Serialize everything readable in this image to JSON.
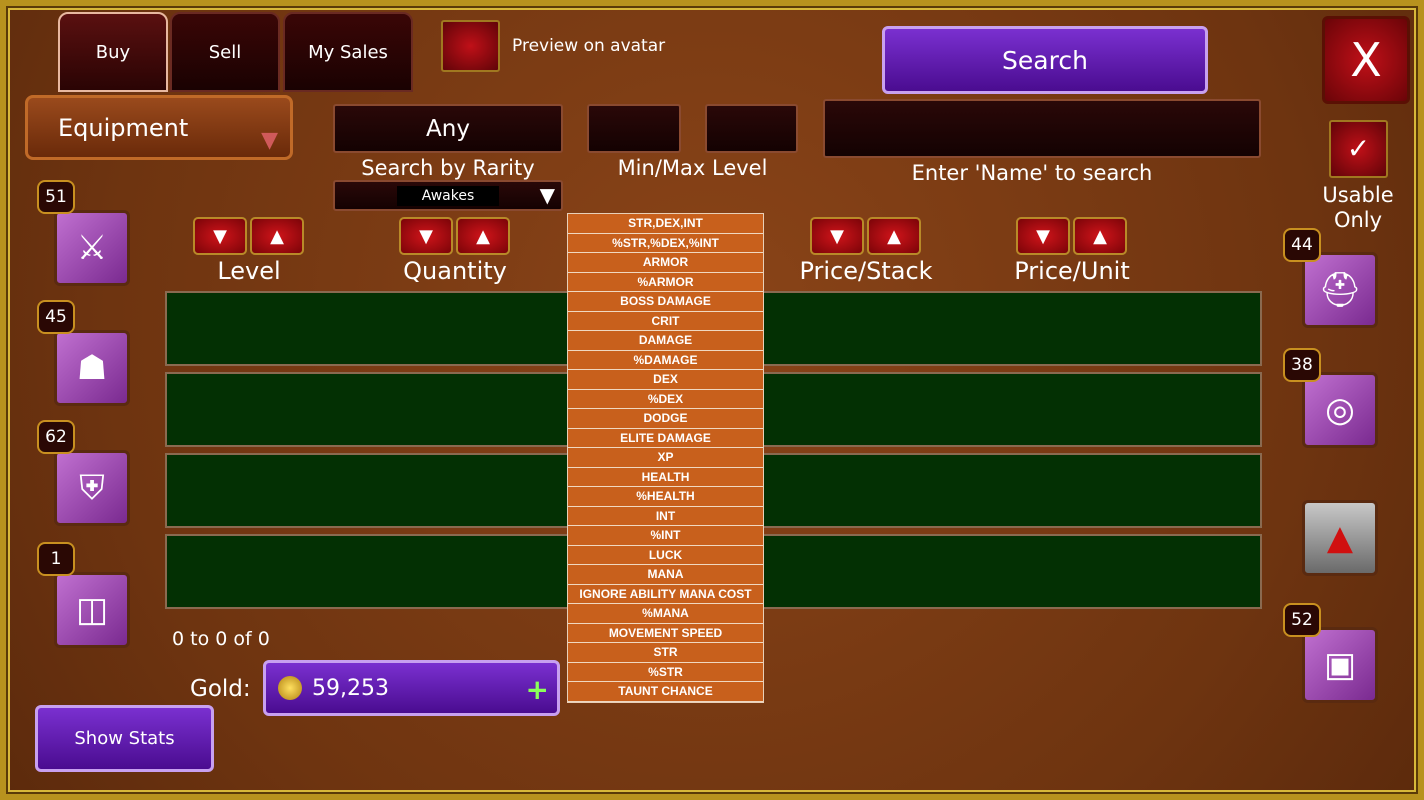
{
  "tabs": [
    {
      "label": "Buy",
      "active": true
    },
    {
      "label": "Sell"
    },
    {
      "label": "My Sales"
    }
  ],
  "preview_label": "Preview on avatar",
  "search_button": "Search",
  "close_label": "X",
  "category": "Equipment",
  "rarity": {
    "value": "Any",
    "label": "Search by Rarity"
  },
  "level_label": "Min/Max Level",
  "name_label": "Enter 'Name' to search",
  "stat_filter": "Awakes",
  "usable_only": {
    "label": "Usable Only",
    "checked": true
  },
  "sort_columns": [
    "Level",
    "Quantity",
    "Price/Stack",
    "Price/Unit"
  ],
  "stat_options": [
    "STR,DEX,INT",
    "%STR,%DEX,%INT",
    "ARMOR",
    "%ARMOR",
    "BOSS DAMAGE",
    "CRIT",
    "DAMAGE",
    "%DAMAGE",
    "DEX",
    "%DEX",
    "DODGE",
    "ELITE DAMAGE",
    "XP",
    "HEALTH",
    "%HEALTH",
    "INT",
    "%INT",
    "LUCK",
    "MANA",
    "IGNORE ABILITY MANA COST",
    "%MANA",
    "MOVEMENT SPEED",
    "STR",
    "%STR",
    "TAUNT CHANCE"
  ],
  "pagination": "0 to 0 of 0",
  "gold": {
    "label": "Gold:",
    "value": "59,253"
  },
  "show_stats": "Show Stats",
  "left_items": [
    {
      "level": "51",
      "icon": "crossed-blades-icon"
    },
    {
      "level": "45",
      "icon": "hood-icon"
    },
    {
      "level": "62",
      "icon": "armor-icon"
    },
    {
      "level": "1",
      "icon": "belt-icon"
    }
  ],
  "right_items": [
    {
      "level": "44",
      "icon": "gold-helmet-icon"
    },
    {
      "level": "38",
      "icon": "amulet-icon"
    },
    {
      "level": "",
      "icon": "pendant-icon"
    },
    {
      "level": "52",
      "icon": "treasure-chest-icon"
    }
  ]
}
